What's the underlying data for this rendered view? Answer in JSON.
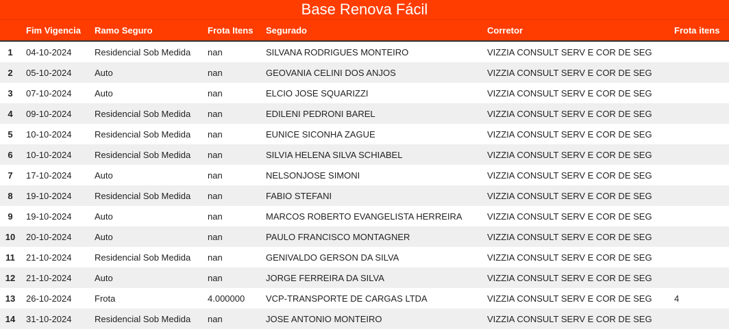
{
  "title": "Base Renova Fácil",
  "columns": [
    "",
    "Fim Vigencia",
    "Ramo Seguro",
    "Frota Itens",
    "Segurado",
    "Corretor",
    "Frota itens"
  ],
  "rows": [
    [
      "1",
      "04-10-2024",
      "Residencial Sob Medida",
      "nan",
      "SILVANA RODRIGUES MONTEIRO",
      "VIZZIA CONSULT SERV E COR DE SEG",
      ""
    ],
    [
      "2",
      "05-10-2024",
      "Auto",
      "nan",
      "GEOVANIA CELINI DOS ANJOS",
      "VIZZIA CONSULT SERV E COR DE SEG",
      ""
    ],
    [
      "3",
      "07-10-2024",
      "Auto",
      "nan",
      "ELCIO JOSE SQUARIZZI",
      "VIZZIA CONSULT SERV E COR DE SEG",
      ""
    ],
    [
      "4",
      "09-10-2024",
      "Residencial Sob Medida",
      "nan",
      "EDILENI PEDRONI BAREL",
      "VIZZIA CONSULT SERV E COR DE SEG",
      ""
    ],
    [
      "5",
      "10-10-2024",
      "Residencial Sob Medida",
      "nan",
      "EUNICE SICONHA ZAGUE",
      "VIZZIA CONSULT SERV E COR DE SEG",
      ""
    ],
    [
      "6",
      "10-10-2024",
      "Residencial Sob Medida",
      "nan",
      "SILVIA HELENA SILVA SCHIABEL",
      "VIZZIA CONSULT SERV E COR DE SEG",
      ""
    ],
    [
      "7",
      "17-10-2024",
      "Auto",
      "nan",
      "NELSONJOSE SIMONI",
      "VIZZIA CONSULT SERV E COR DE SEG",
      ""
    ],
    [
      "8",
      "19-10-2024",
      "Residencial Sob Medida",
      "nan",
      "FABIO STEFANI",
      "VIZZIA CONSULT SERV E COR DE SEG",
      ""
    ],
    [
      "9",
      "19-10-2024",
      "Auto",
      "nan",
      "MARCOS ROBERTO EVANGELISTA HERREIRA",
      "VIZZIA CONSULT SERV E COR DE SEG",
      ""
    ],
    [
      "10",
      "20-10-2024",
      "Auto",
      "nan",
      "PAULO FRANCISCO MONTAGNER",
      "VIZZIA CONSULT SERV E COR DE SEG",
      ""
    ],
    [
      "11",
      "21-10-2024",
      "Residencial Sob Medida",
      "nan",
      "GENIVALDO GERSON DA SILVA",
      "VIZZIA CONSULT SERV E COR DE SEG",
      ""
    ],
    [
      "12",
      "21-10-2024",
      "Auto",
      "nan",
      "JORGE FERREIRA DA SILVA",
      "VIZZIA CONSULT SERV E COR DE SEG",
      ""
    ],
    [
      "13",
      "26-10-2024",
      "Frota",
      "4.000000",
      "VCP-TRANSPORTE DE CARGAS LTDA",
      "VIZZIA CONSULT SERV E COR DE SEG",
      "4"
    ],
    [
      "14",
      "31-10-2024",
      "Residencial Sob Medida",
      "nan",
      "JOSE ANTONIO MONTEIRO",
      "VIZZIA CONSULT SERV E COR DE SEG",
      ""
    ]
  ],
  "colors": {
    "header_bg": "#ff3d00",
    "header_text": "#ffffff",
    "stripe": "#efefef"
  }
}
